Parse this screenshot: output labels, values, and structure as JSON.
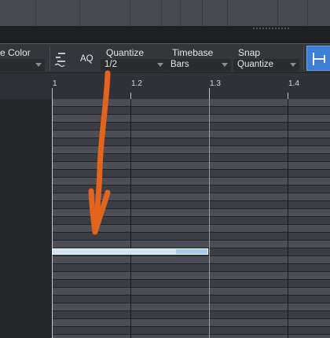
{
  "toolbar": {
    "color_label": "e Color",
    "aq_label": "AQ",
    "quantize": {
      "label": "Quantize",
      "value": "1/2"
    },
    "timebase": {
      "label": "Timebase",
      "value": "Bars"
    },
    "snap": {
      "label": "Snap",
      "value": "Quantize"
    }
  },
  "ruler": {
    "ticks": [
      "1",
      "1.2",
      "1.3",
      "1.4"
    ]
  },
  "colors": {
    "accent": "#3d7fd6",
    "note_fill": "#cfe4f8",
    "annotation_arrow": "#e3651d"
  },
  "annotation": {
    "type": "arrow",
    "points_to": "quantize-value"
  }
}
